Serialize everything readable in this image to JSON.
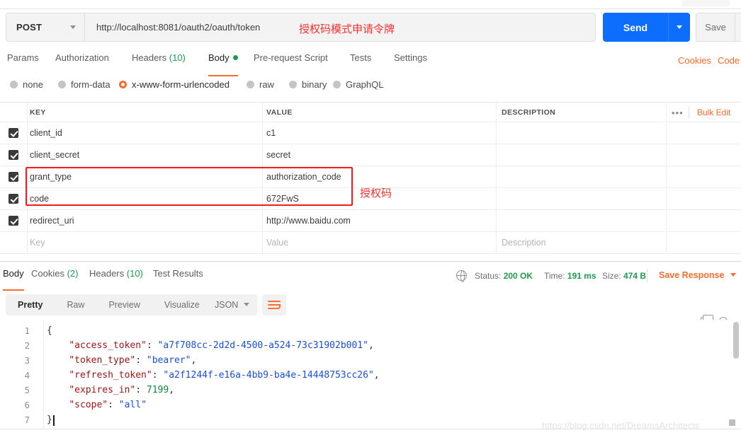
{
  "request": {
    "method": "POST",
    "url": "http://localhost:8081/oauth2/oauth/token",
    "url_annotation": "授权码模式申请令牌",
    "send_label": "Send",
    "save_label": "Save",
    "tabs": [
      {
        "label": "Params",
        "count": "",
        "active": false
      },
      {
        "label": "Authorization",
        "count": "",
        "active": false
      },
      {
        "label": "Headers",
        "count": "(10)",
        "active": false
      },
      {
        "label": "Body",
        "count": "",
        "active": true
      },
      {
        "label": "Pre-request Script",
        "count": "",
        "active": false
      },
      {
        "label": "Tests",
        "count": "",
        "active": false
      },
      {
        "label": "Settings",
        "count": "",
        "active": false
      }
    ],
    "cookies_link": "Cookies",
    "code_link": "Code",
    "body_types": [
      {
        "label": "none",
        "selected": false
      },
      {
        "label": "form-data",
        "selected": false
      },
      {
        "label": "x-www-form-urlencoded",
        "selected": true
      },
      {
        "label": "raw",
        "selected": false
      },
      {
        "label": "binary",
        "selected": false
      },
      {
        "label": "GraphQL",
        "selected": false
      }
    ]
  },
  "params_table": {
    "headers": {
      "key": "KEY",
      "value": "VALUE",
      "description": "DESCRIPTION"
    },
    "dots": "•••",
    "bulk_edit": "Bulk Edit",
    "rows": [
      {
        "checked": true,
        "key": "client_id",
        "value": "c1",
        "description": ""
      },
      {
        "checked": true,
        "key": "client_secret",
        "value": "secret",
        "description": ""
      },
      {
        "checked": true,
        "key": "grant_type",
        "value": "authorization_code",
        "description": ""
      },
      {
        "checked": true,
        "key": "code",
        "value": "672FwS",
        "description": ""
      },
      {
        "checked": true,
        "key": "redirect_uri",
        "value": "http://www.baidu.com",
        "description": ""
      }
    ],
    "empty_row": {
      "key": "Key",
      "value": "Value",
      "description": "Description"
    },
    "highlight_note": "授权码",
    "highlight_color": "#ee1c1c"
  },
  "response": {
    "tabs": [
      {
        "label": "Body",
        "count": "",
        "active": true
      },
      {
        "label": "Cookies",
        "count": "(2)",
        "active": false
      },
      {
        "label": "Headers",
        "count": "(10)",
        "active": false
      },
      {
        "label": "Test Results",
        "count": "",
        "active": false
      }
    ],
    "status_label": "Status:",
    "status_value": "200 OK",
    "time_label": "Time:",
    "time_value": "191 ms",
    "size_label": "Size:",
    "size_value": "474 B",
    "save_response": "Save Response",
    "viewer_modes": [
      {
        "label": "Pretty",
        "active": true
      },
      {
        "label": "Raw",
        "active": false
      },
      {
        "label": "Preview",
        "active": false
      },
      {
        "label": "Visualize",
        "active": false
      }
    ],
    "format": "JSON",
    "body_json": {
      "access_token": "a7f708cc-2d2d-4500-a524-73c31902b001",
      "token_type": "bearer",
      "refresh_token": "a2f1244f-e16a-4bb9-ba4e-14448753cc26",
      "expires_in": 7199,
      "scope": "all"
    },
    "code_lines": [
      {
        "num": "1",
        "open_brace": "{"
      },
      {
        "num": "2",
        "key": "\"access_token\"",
        "colon": ": ",
        "value": "\"a7f708cc-2d2d-4500-a524-73c31902b001\"",
        "type": "string",
        "comma": ","
      },
      {
        "num": "3",
        "key": "\"token_type\"",
        "colon": ": ",
        "value": "\"bearer\"",
        "type": "string",
        "comma": ","
      },
      {
        "num": "4",
        "key": "\"refresh_token\"",
        "colon": ": ",
        "value": "\"a2f1244f-e16a-4bb9-ba4e-14448753cc26\"",
        "type": "string",
        "comma": ","
      },
      {
        "num": "5",
        "key": "\"expires_in\"",
        "colon": ": ",
        "value": "7199",
        "type": "number",
        "comma": ","
      },
      {
        "num": "6",
        "key": "\"scope\"",
        "colon": ": ",
        "value": "\"all\"",
        "type": "string",
        "comma": ""
      },
      {
        "num": "7",
        "close_brace": "}"
      }
    ]
  },
  "watermark": "https://blog.csdn.net/DreamsArchitects",
  "colors": {
    "accent_orange": "#ff6c2c",
    "send_blue": "#0d6efd",
    "green": "#1f9b4e",
    "annotation_red": "#ff2f2f"
  }
}
